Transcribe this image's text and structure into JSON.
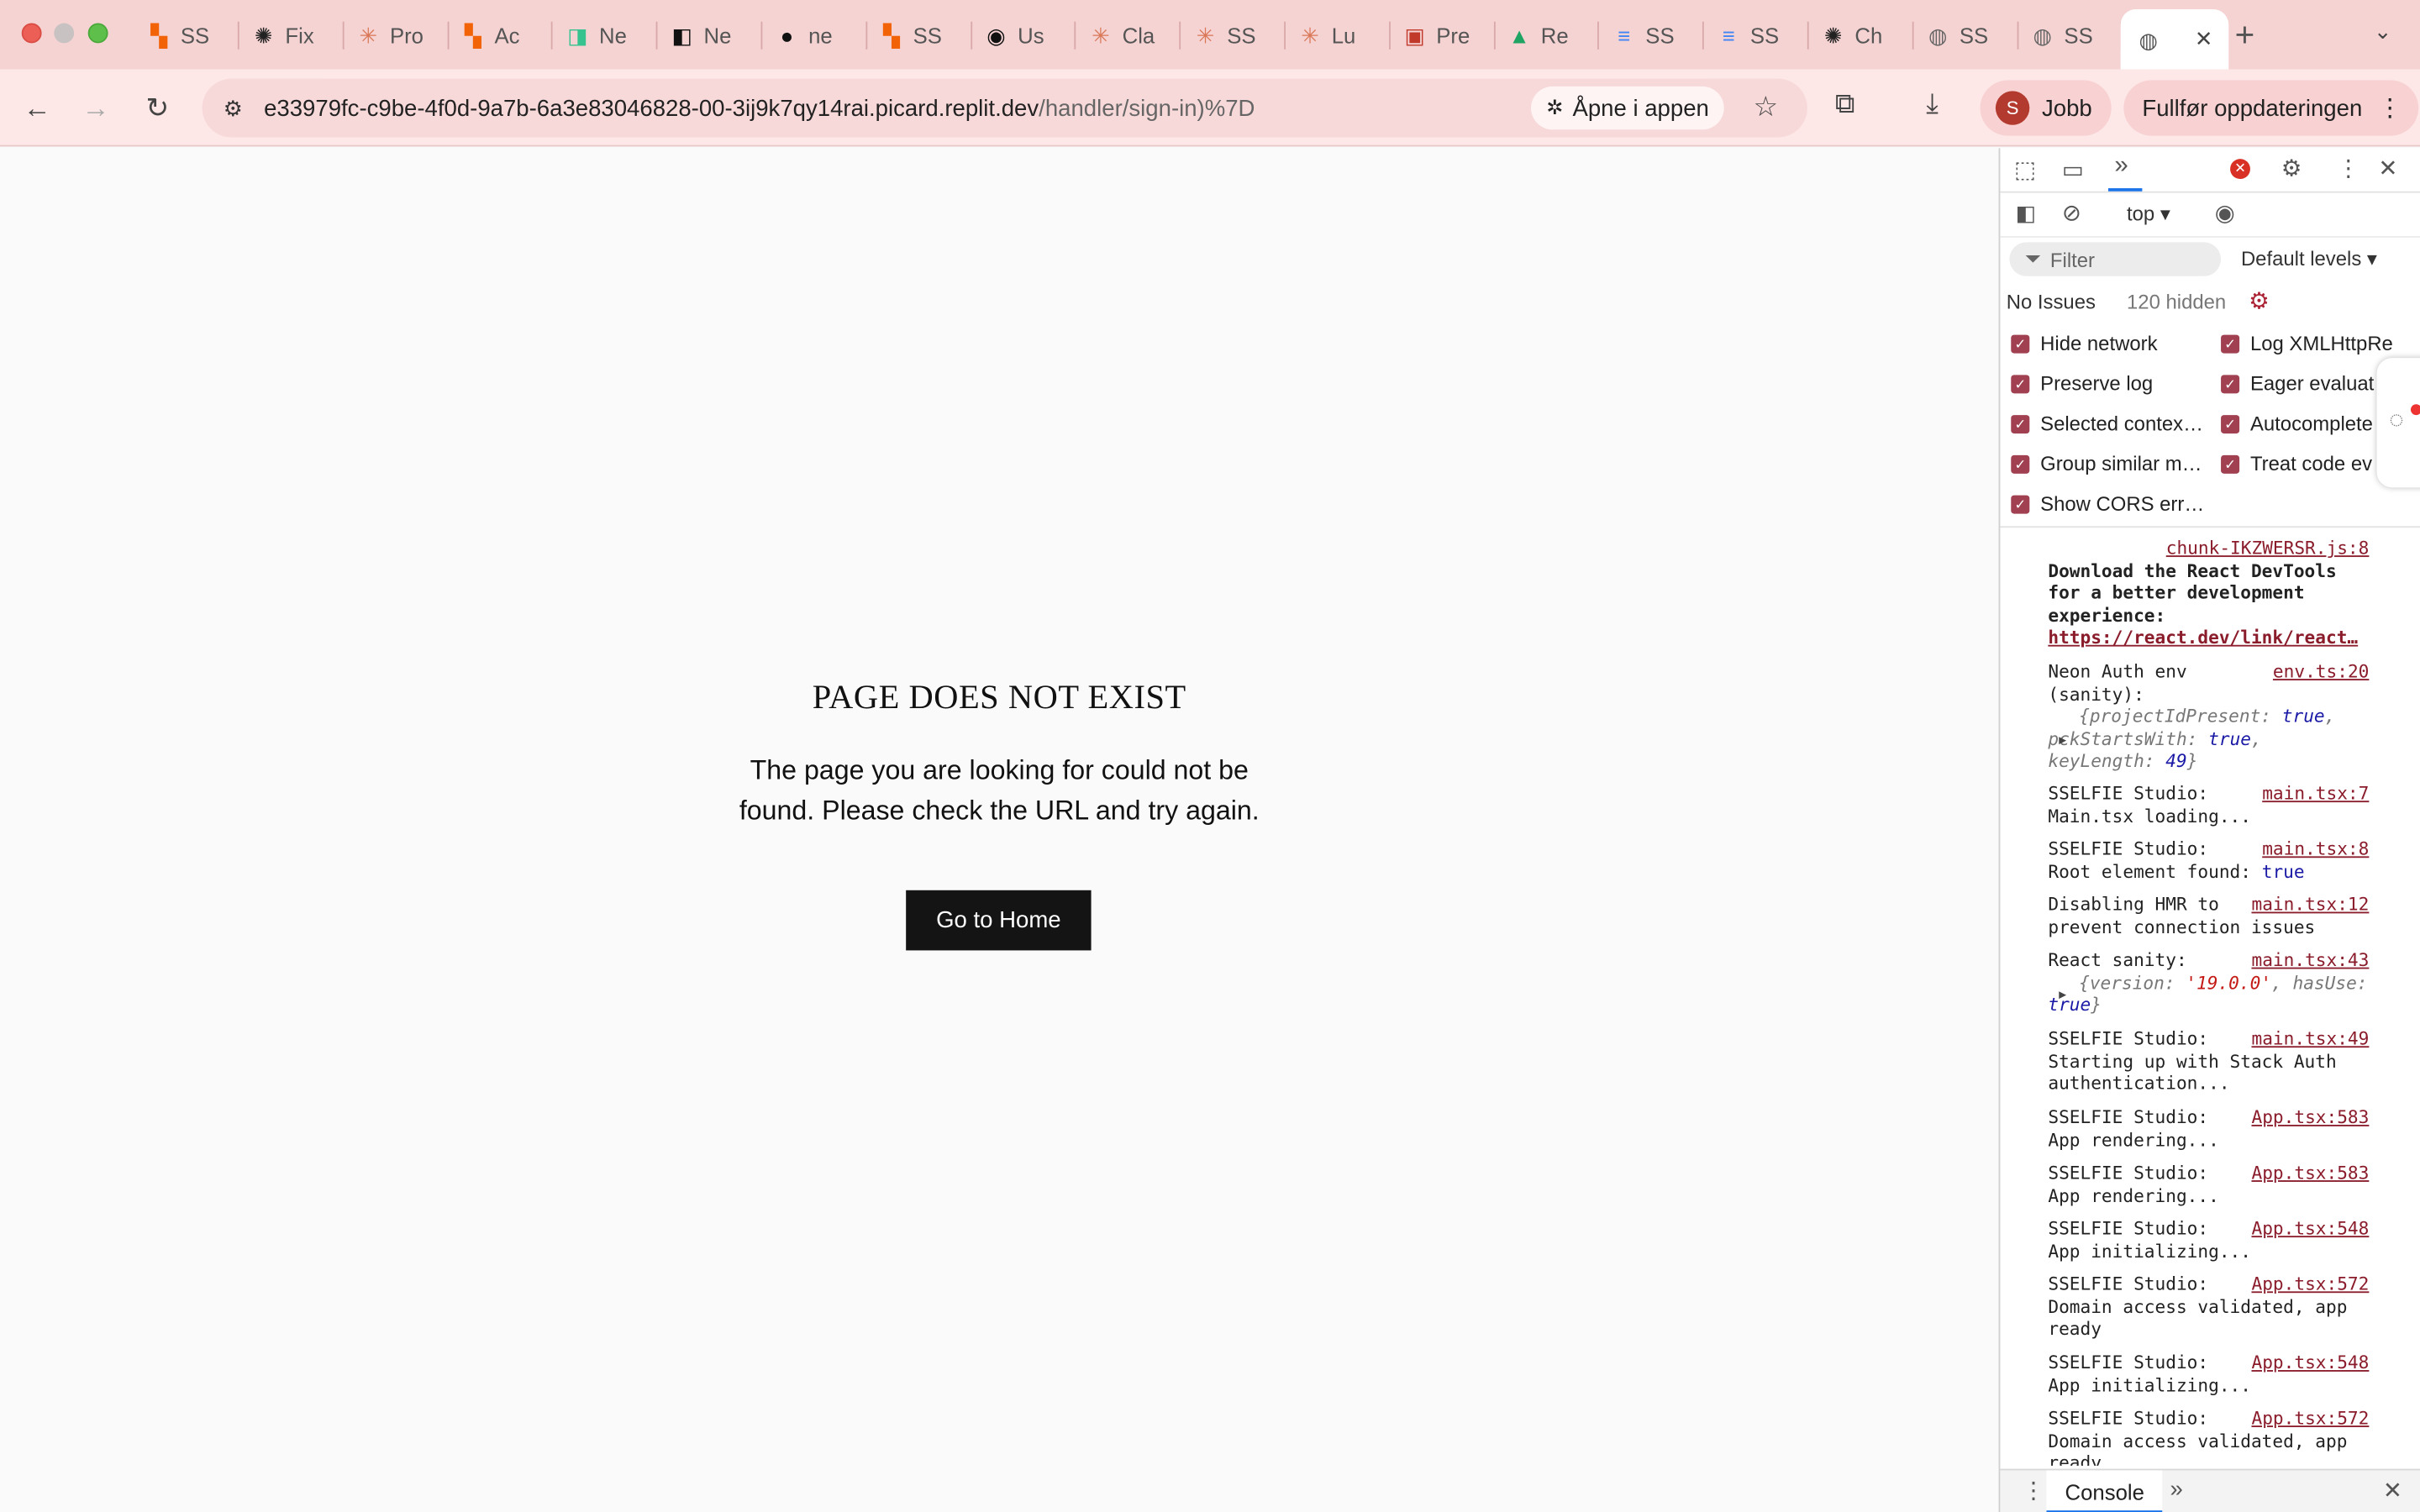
{
  "tabs": [
    {
      "label": "SS",
      "icon": "replit-icon",
      "glyph": "▚",
      "color": "#f26207"
    },
    {
      "label": "Fix",
      "icon": "openai-icon",
      "glyph": "✺",
      "color": "#222222"
    },
    {
      "label": "Pro",
      "icon": "claude-icon",
      "glyph": "✳",
      "color": "#d97757"
    },
    {
      "label": "Ac",
      "icon": "replit-icon",
      "glyph": "▚",
      "color": "#f26207"
    },
    {
      "label": "Ne",
      "icon": "neon-icon",
      "glyph": "◨",
      "color": "#37c38f"
    },
    {
      "label": "Ne",
      "icon": "neon-dark-icon",
      "glyph": "◧",
      "color": "#111111"
    },
    {
      "label": "ne",
      "icon": "github-icon",
      "glyph": "●",
      "color": "#111111"
    },
    {
      "label": "SS",
      "icon": "replit-icon",
      "glyph": "▚",
      "color": "#f26207"
    },
    {
      "label": "Us",
      "icon": "stack-auth-icon",
      "glyph": "◉",
      "color": "#111111"
    },
    {
      "label": "Cla",
      "icon": "claude-icon",
      "glyph": "✳",
      "color": "#d97757"
    },
    {
      "label": "SS",
      "icon": "claude-icon",
      "glyph": "✳",
      "color": "#d97757"
    },
    {
      "label": "Lu",
      "icon": "claude-icon",
      "glyph": "✳",
      "color": "#d97757"
    },
    {
      "label": "Pre",
      "icon": "prisma-icon",
      "glyph": "▣",
      "color": "#c0392b"
    },
    {
      "label": "Re",
      "icon": "google-drive-icon",
      "glyph": "▲",
      "color": "#1fa463"
    },
    {
      "label": "SS",
      "icon": "google-docs-icon",
      "glyph": "≡",
      "color": "#4285f4"
    },
    {
      "label": "SS",
      "icon": "google-docs-icon",
      "glyph": "≡",
      "color": "#4285f4"
    },
    {
      "label": "Ch",
      "icon": "openai-icon",
      "glyph": "✺",
      "color": "#222222"
    },
    {
      "label": "SS",
      "icon": "globe-icon",
      "glyph": "◍",
      "color": "#666666"
    },
    {
      "label": "SS",
      "icon": "globe-icon",
      "glyph": "◍",
      "color": "#666666"
    }
  ],
  "active_tab": {
    "icon": "globe-icon",
    "glyph": "◍",
    "close": "✕"
  },
  "new_tab": "+",
  "address": {
    "host": "e33979fc-c9be-4f0d-9a7b-6a3e83046828-00-3ij9k7qy14rai.picard.replit.dev",
    "path": "/handler/sign-in)%7D",
    "open_in_app": "Åpne i appen"
  },
  "profile": {
    "initial": "S",
    "label": "Jobb"
  },
  "update_button": "Fullfør oppdateringen",
  "page": {
    "title": "PAGE DOES NOT EXIST",
    "message": "The page you are looking for could not be found. Please check the URL and try again.",
    "button": "Go to Home"
  },
  "devtools": {
    "context": "top",
    "filter_placeholder": "Filter",
    "levels": "Default levels",
    "issues": "No Issues",
    "hidden": "120 hidden",
    "settings": [
      "Hide network",
      "Log XMLHttpRe",
      "Preserve log",
      "Eager evaluat",
      "Selected contex…",
      "Autocomplete",
      "Group similar m…",
      "Treat code ev",
      "Show CORS err…"
    ],
    "drawer_tab": "Console"
  },
  "console": {
    "m1": {
      "src": "chunk-IKZWERSR.js:8",
      "text": "Download the React DevTools for a better development experience:",
      "link": "https://react.dev/link/react…"
    },
    "m2": {
      "src": "env.ts:20",
      "text": "Neon Auth env (sanity):",
      "k1": "projectIdPresent",
      "v1": "true",
      "k2": "pckStartsWith",
      "v2": "true",
      "k3": "keyLength",
      "v3": "49"
    },
    "m3": {
      "src": "main.tsx:7",
      "text": "SSELFIE Studio: Main.tsx loading..."
    },
    "m4": {
      "src": "main.tsx:8",
      "text": "SSELFIE Studio: Root element found:",
      "val": "true"
    },
    "m5": {
      "src": "main.tsx:12",
      "text": "Disabling HMR to prevent connection issues"
    },
    "m6": {
      "src": "main.tsx:43",
      "text": "React sanity:",
      "k1": "version",
      "v1": "'19.0.0'",
      "k2": "hasUse",
      "v2": "true"
    },
    "m7": {
      "src": "main.tsx:49",
      "text": "SSELFIE Studio: Starting up with Stack Auth authentication..."
    },
    "m8": {
      "src": "App.tsx:583",
      "text": "SSELFIE Studio: App rendering..."
    },
    "m9": {
      "src": "App.tsx:583",
      "text": "SSELFIE Studio: App rendering..."
    },
    "m10": {
      "src": "App.tsx:548",
      "text": "SSELFIE Studio: App initializing..."
    },
    "m11": {
      "src": "App.tsx:572",
      "text": "SSELFIE Studio: Domain access validated, app ready"
    },
    "m12": {
      "src": "App.tsx:548",
      "text": "SSELFIE Studio: App initializing..."
    },
    "m13": {
      "src": "App.tsx:572",
      "text": "SSELFIE Studio: Domain access validated, app ready"
    }
  }
}
